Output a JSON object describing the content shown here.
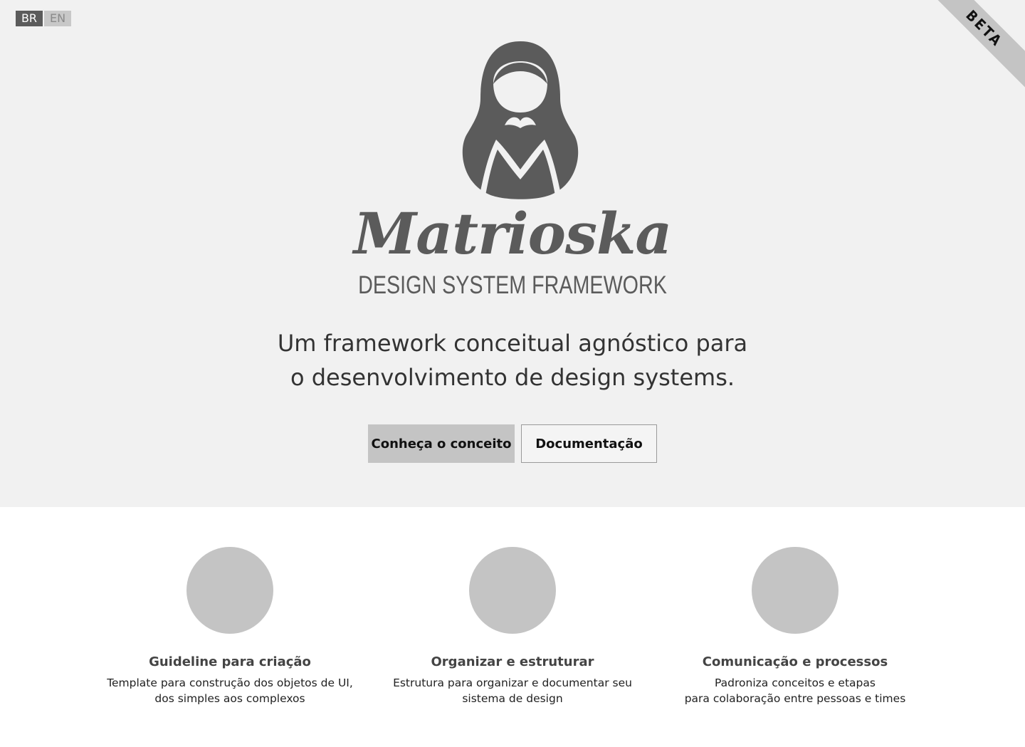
{
  "language_switcher": {
    "options": [
      {
        "code": "BR",
        "active": true
      },
      {
        "code": "EN",
        "active": false
      }
    ]
  },
  "ribbon": {
    "label": "BETA"
  },
  "logo": {
    "icon": "matryoshka-doll-icon",
    "title": "Matrioska",
    "subtitle": "DESIGN SYSTEM FRAMEWORK"
  },
  "hero": {
    "tagline_line1": "Um framework conceitual agnóstico para",
    "tagline_line2": "o desenvolvimento de design systems.",
    "primary_button": "Conheça o conceito",
    "secondary_button": "Documentação"
  },
  "features": [
    {
      "icon": "placeholder-circle-icon",
      "title": "Guideline para criação",
      "desc_line1": "Template para construção dos objetos de UI,",
      "desc_line2": "dos simples aos complexos"
    },
    {
      "icon": "placeholder-circle-icon",
      "title": "Organizar e estruturar",
      "desc_line1": "Estrutura para organizar e documentar seu",
      "desc_line2": "sistema de design"
    },
    {
      "icon": "placeholder-circle-icon",
      "title": "Comunicação e processos",
      "desc_line1": "Padroniza conceitos e etapas",
      "desc_line2": "para colaboração entre pessoas e times"
    }
  ],
  "colors": {
    "hero_background": "#f1f1f1",
    "logo_gray": "#5b5b5b",
    "accent_gray": "#c4c4c4"
  }
}
